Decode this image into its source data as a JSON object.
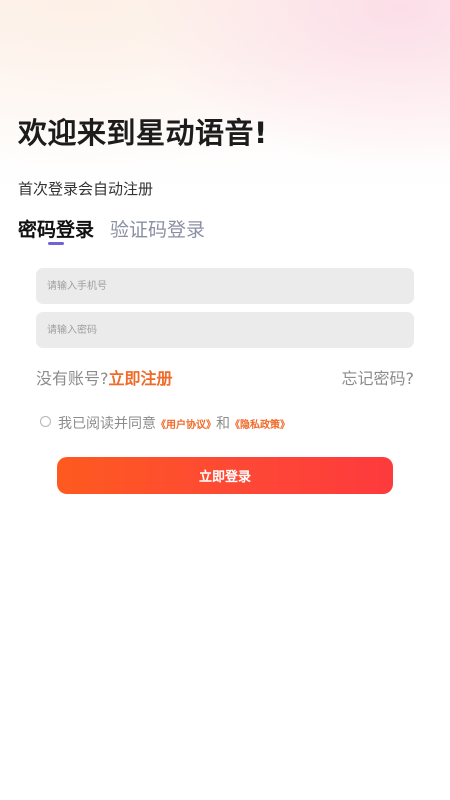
{
  "header": {
    "welcome": "欢迎来到星动语音!",
    "subtitle": "首次登录会自动注册"
  },
  "tabs": [
    {
      "label": "密码登录",
      "active": true
    },
    {
      "label": "验证码登录",
      "active": false
    }
  ],
  "form": {
    "phone_placeholder": "请输入手机号",
    "phone_value": "",
    "password_placeholder": "请输入密码",
    "password_value": ""
  },
  "links": {
    "no_account": "没有账号?",
    "register": "立即注册",
    "forgot_password": "忘记密码?"
  },
  "agreement": {
    "checked": false,
    "prefix": "我已阅读并同意",
    "user_agreement": "《用户协议》",
    "conjunction": "和",
    "privacy_policy": "《隐私政策》"
  },
  "login_button": "立即登录",
  "colors": {
    "accent": "#f06a2a",
    "tab_indicator": "#6f63d8",
    "button_gradient_start": "#fe5a1f",
    "button_gradient_end": "#fd3a3c"
  }
}
